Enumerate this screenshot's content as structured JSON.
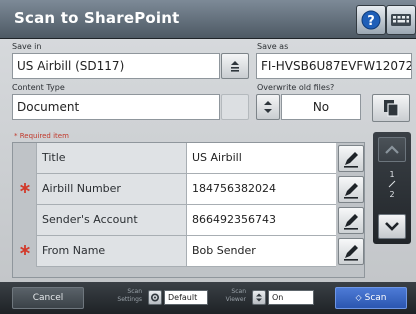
{
  "window": {
    "title": "Scan to SharePoint"
  },
  "form": {
    "save_in": {
      "label": "Save in",
      "value": "US Airbill (SD117)"
    },
    "save_as": {
      "label": "Save as",
      "value": "FI-HVSB6U87EVFW12072"
    },
    "content_type": {
      "label": "Content Type",
      "value": "Document"
    },
    "overwrite": {
      "label": "Overwrite old files?",
      "value": "No"
    },
    "required_note": "* Required item"
  },
  "table": {
    "rows": [
      {
        "label": "Title",
        "value": "US Airbill",
        "required": false
      },
      {
        "label": "Airbill Number",
        "value": "184756382024",
        "required": true
      },
      {
        "label": "Sender's Account",
        "value": "866492356743",
        "required": false
      },
      {
        "label": "From Name",
        "value": "Bob Sender",
        "required": true
      }
    ]
  },
  "pager": {
    "current": "1",
    "total": "2"
  },
  "bottom": {
    "cancel_label": "Cancel",
    "scan_settings_label_1": "Scan",
    "scan_settings_label_2": "Settings",
    "scan_settings_value": "Default",
    "scan_viewer_label_1": "Scan",
    "scan_viewer_label_2": "Viewer",
    "scan_viewer_value": "On",
    "scan_label": "Scan"
  },
  "icons": {
    "help": "help-icon",
    "keyboard": "keyboard-icon",
    "dropdown": "dropdown-icon",
    "stepper": "stepper-icon",
    "document": "document-icon",
    "edit": "edit-pencil-icon",
    "required": "required-asterisk-icon",
    "scroll_up": "chevron-up-icon",
    "scroll_down": "chevron-down-icon",
    "settings": "gear-icon",
    "scan": "scan-icon"
  },
  "colors": {
    "title_bar": "#5f6b77",
    "panel": "#cfd2d5",
    "required": "#d23a2b",
    "scan_button": "#3a67c4"
  }
}
